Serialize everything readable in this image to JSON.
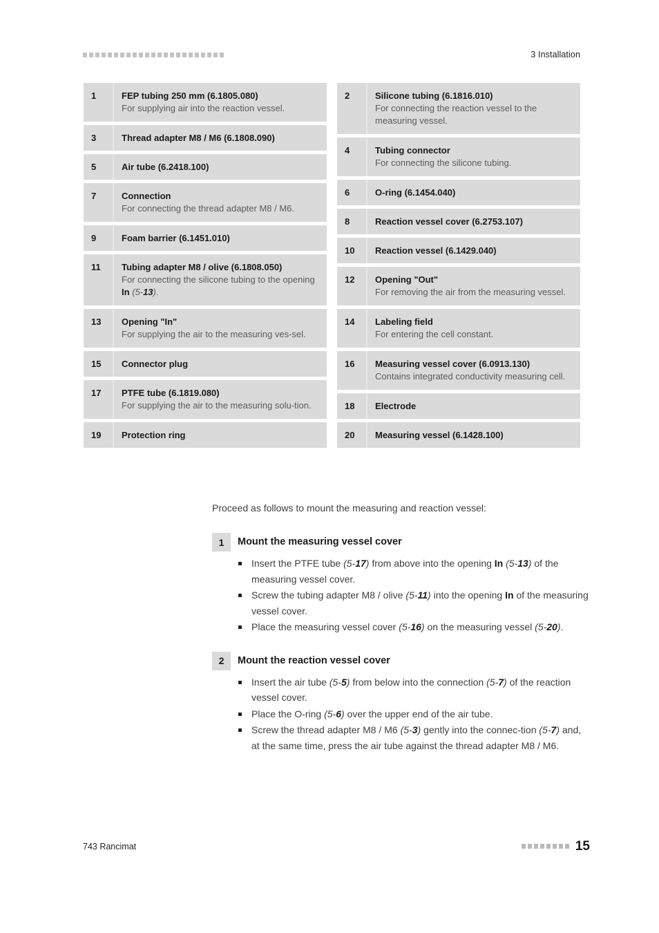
{
  "header": {
    "decoration_squares": 23,
    "title": "3 Installation",
    "square_color": "#c3c3c3"
  },
  "legend": {
    "row_bg": "#dadada",
    "left_column": [
      {
        "num": "1",
        "title": "FEP tubing 250 mm (6.1805.080)",
        "desc": "For supplying air into the reaction vessel."
      },
      {
        "num": "3",
        "title": "Thread adapter M8 / M6 (6.1808.090)",
        "desc": ""
      },
      {
        "num": "5",
        "title": "Air tube (6.2418.100)",
        "desc": ""
      },
      {
        "num": "7",
        "title": "Connection",
        "desc": "For connecting the thread adapter M8 / M6."
      },
      {
        "num": "9",
        "title": "Foam barrier (6.1451.010)",
        "desc": ""
      },
      {
        "num": "11",
        "title": "Tubing adapter M8 / olive (6.1808.050)",
        "desc_html": "For connecting the silicone tubing to the opening <b>In</b> <i>(5-<b>13</b>)</i>."
      },
      {
        "num": "13",
        "title": "Opening \"In\"",
        "desc": "For supplying the air to the measuring ves-sel."
      },
      {
        "num": "15",
        "title": "Connector plug",
        "desc": ""
      },
      {
        "num": "17",
        "title": "PTFE tube (6.1819.080)",
        "desc": "For supplying the air to the measuring solu-tion."
      },
      {
        "num": "19",
        "title": "Protection ring",
        "desc": ""
      }
    ],
    "right_column": [
      {
        "num": "2",
        "title": "Silicone tubing (6.1816.010)",
        "desc": "For connecting the reaction vessel to the measuring vessel."
      },
      {
        "num": "4",
        "title": "Tubing connector",
        "desc": "For connecting the silicone tubing."
      },
      {
        "num": "6",
        "title": "O-ring (6.1454.040)",
        "desc": ""
      },
      {
        "num": "8",
        "title": "Reaction vessel cover (6.2753.107)",
        "desc": ""
      },
      {
        "num": "10",
        "title": "Reaction vessel (6.1429.040)",
        "desc": ""
      },
      {
        "num": "12",
        "title": "Opening \"Out\"",
        "desc": "For removing the air from the measuring vessel."
      },
      {
        "num": "14",
        "title": "Labeling field",
        "desc": "For entering the cell constant."
      },
      {
        "num": "16",
        "title": "Measuring vessel cover (6.0913.130)",
        "desc": "Contains integrated conductivity measuring cell."
      },
      {
        "num": "18",
        "title": "Electrode",
        "desc": ""
      },
      {
        "num": "20",
        "title": "Measuring vessel (6.1428.100)",
        "desc": ""
      }
    ]
  },
  "intro": "Proceed as follows to mount the measuring and reaction vessel:",
  "steps": [
    {
      "num": "1",
      "title": "Mount the measuring vessel cover",
      "bullets": [
        "Insert the PTFE tube <i>(5-<b>17</b>)</i> from above into the opening <b>In</b> <i>(5-<b>13</b>)</i> of the measuring vessel cover.",
        "Screw the tubing adapter M8 / olive <i>(5-<b>11</b>)</i> into the opening <b>In</b> of the measuring vessel cover.",
        "Place the measuring vessel cover <i>(5-<b>16</b>)</i> on the measuring vessel <i>(5-<b>20</b>)</i>."
      ]
    },
    {
      "num": "2",
      "title": "Mount the reaction vessel cover",
      "bullets": [
        "Insert the air tube <i>(5-<b>5</b>)</i> from below into the connection <i>(5-<b>7</b>)</i> of the reaction vessel cover.",
        "Place the O-ring <i>(5-<b>6</b>)</i> over the upper end of the air tube.",
        "Screw the thread adapter M8 / M6 <i>(5-<b>3</b>)</i> gently into the connec-tion <i>(5-<b>7</b>)</i> and, at the same time, press the air tube against the thread adapter M8 / M6."
      ]
    }
  ],
  "footer": {
    "left": "743 Rancimat",
    "decoration_squares": 8,
    "page_number": "15",
    "square_color": "#b9b9b9"
  }
}
